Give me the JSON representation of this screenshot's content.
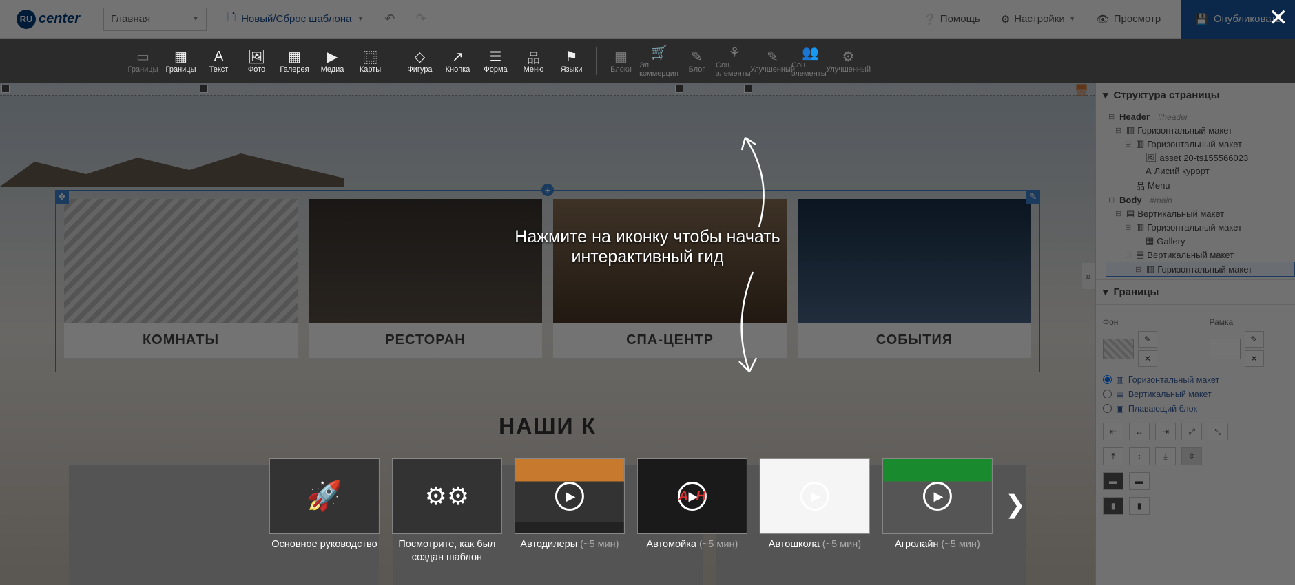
{
  "topbar": {
    "logo_badge": "RU",
    "logo_text": "center",
    "page_select": "Главная",
    "new_reset": "Новый/Сброс шаблона",
    "help": "Помощь",
    "settings": "Настройки",
    "preview": "Просмотр",
    "publish": "Опубликовать"
  },
  "toolbar": {
    "items": [
      {
        "label": "Границы",
        "dim": true,
        "icon": "▭"
      },
      {
        "label": "Границы",
        "dim": false,
        "icon": "▦"
      },
      {
        "label": "Текст",
        "dim": false,
        "icon": "A"
      },
      {
        "label": "Фото",
        "dim": false,
        "icon": "🖼"
      },
      {
        "label": "Галерея",
        "dim": false,
        "icon": "▦"
      },
      {
        "label": "Медиа",
        "dim": false,
        "icon": "▶"
      },
      {
        "label": "Карты",
        "dim": false,
        "icon": "⿴"
      },
      {
        "sep": true
      },
      {
        "label": "Фигура",
        "dim": false,
        "icon": "◇"
      },
      {
        "label": "Кнопка",
        "dim": false,
        "icon": "↗"
      },
      {
        "label": "Форма",
        "dim": false,
        "icon": "☰"
      },
      {
        "label": "Меню",
        "dim": false,
        "icon": "品"
      },
      {
        "label": "Языки",
        "dim": false,
        "icon": "⚑"
      },
      {
        "sep": true
      },
      {
        "label": "Блоки",
        "dim": true,
        "icon": "▦"
      },
      {
        "label": "Эл. коммерция",
        "dim": true,
        "icon": "🛒"
      },
      {
        "label": "Блог",
        "dim": true,
        "icon": "✎"
      },
      {
        "label": "Соц. элементы",
        "dim": true,
        "icon": "⚘"
      },
      {
        "label": "Улучшенный",
        "dim": true,
        "icon": "✎"
      },
      {
        "label": "Соц. элементы",
        "dim": true,
        "icon": "👥"
      },
      {
        "label": "Улучшенный",
        "dim": true,
        "icon": "⚙"
      }
    ]
  },
  "canvas": {
    "cards": [
      {
        "title": "КОМНАТЫ",
        "cls": "c1"
      },
      {
        "title": "РЕСТОРАН",
        "cls": "c2"
      },
      {
        "title": "СПА-ЦЕНТР",
        "cls": "c3"
      },
      {
        "title": "СОБЫТИЯ",
        "cls": "c4"
      }
    ],
    "section_title": "НАШИ К"
  },
  "right_panel": {
    "structure_title": "Структура страницы",
    "tree": {
      "header": "Header",
      "header_tag": "#header",
      "hlayout": "Горизонтальный макет",
      "asset": "asset 20-ts155566023",
      "resort": "Лисий курорт",
      "menu": "Menu",
      "body": "Body",
      "body_tag": "#main",
      "vlayout": "Вертикальный макет",
      "gallery": "Gallery"
    },
    "borders_title": "Границы",
    "bg": "Фон",
    "frame": "Рамка",
    "layout_h": "Горизонтальный макет",
    "layout_v": "Вертикальный макет",
    "layout_f": "Плавающий блок"
  },
  "tutorial": {
    "hint1": "Нажмите на иконку чтобы начать",
    "hint2": "интерактивный гид",
    "cards": [
      {
        "kind": "rocket",
        "label": "Основное руководство",
        "sub": ""
      },
      {
        "kind": "gears",
        "label": "Посмотрите, как был создан шаблон",
        "sub": ""
      },
      {
        "kind": "orange",
        "label": "Автодилеры",
        "sub": "(~5 мин)"
      },
      {
        "kind": "dark",
        "label": "Автомойка",
        "sub": "(~5 мин)"
      },
      {
        "kind": "white",
        "label": "Автошкола",
        "sub": "(~5 мин)"
      },
      {
        "kind": "green",
        "label": "Агролайн",
        "sub": "(~5 мин)"
      }
    ]
  }
}
